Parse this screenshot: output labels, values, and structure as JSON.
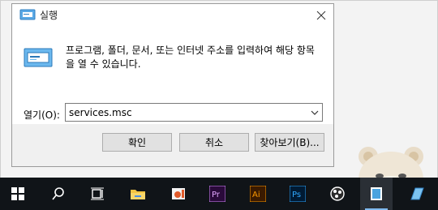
{
  "dialog": {
    "title": "실행",
    "description": "프로그램, 폴더, 문서, 또는 인터넷 주소를 입력하여 해당 항목을 열 수 있습니다.",
    "open_label": "열기(O):",
    "open_value": "services.msc",
    "ok_label": "확인",
    "cancel_label": "취소",
    "browse_label": "찾아보기(B)..."
  },
  "taskbar": {
    "icons": [
      "windows-start-icon",
      "search-icon",
      "task-view-icon",
      "file-explorer-icon",
      "photos-icon",
      "premiere-pro-icon",
      "illustrator-icon",
      "photoshop-icon",
      "obs-icon",
      "app-icon",
      "app-icon-2"
    ],
    "premiere_label": "Pr",
    "illustrator_label": "Ai",
    "photoshop_label": "Ps"
  }
}
